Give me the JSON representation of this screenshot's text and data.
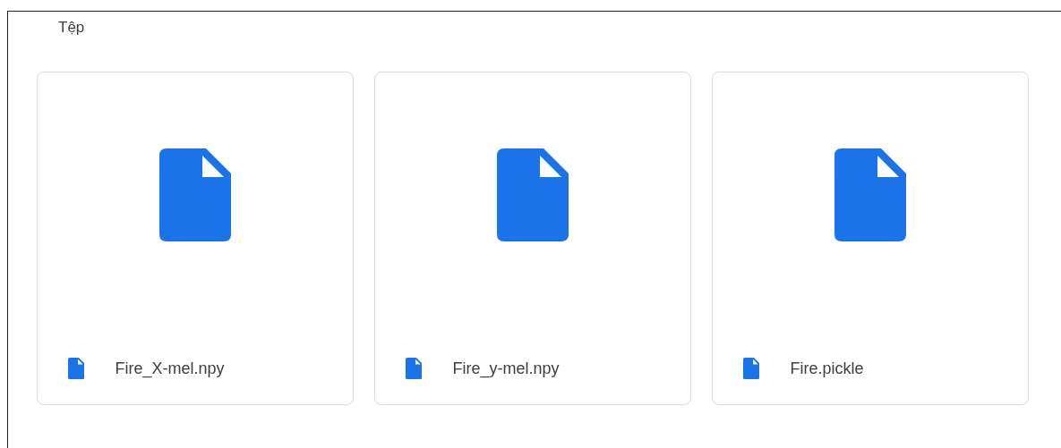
{
  "section": {
    "title": "Tệp"
  },
  "files": [
    {
      "name": "Fire_X-mel.npy"
    },
    {
      "name": "Fire_y-mel.npy"
    },
    {
      "name": "Fire.pickle"
    }
  ]
}
